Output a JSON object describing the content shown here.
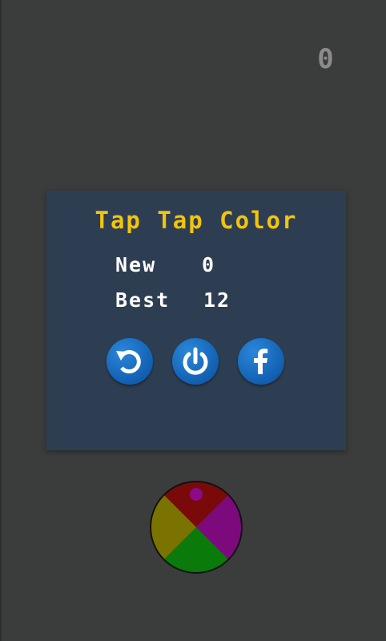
{
  "hud": {
    "current_score": "0"
  },
  "game_over_panel": {
    "title": "Tap Tap Color",
    "new_label": "New",
    "new_value": "0",
    "best_label": "Best",
    "best_value": "12",
    "buttons": [
      {
        "icon": "restart-icon"
      },
      {
        "icon": "power-icon"
      },
      {
        "icon": "facebook-icon"
      }
    ]
  },
  "color_wheel": {
    "segments": [
      {
        "position": "top",
        "color": "#7a0a0a"
      },
      {
        "position": "right",
        "color": "#7d0a7d"
      },
      {
        "position": "bottom",
        "color": "#0a7a0a"
      },
      {
        "position": "left",
        "color": "#7a7300"
      }
    ],
    "ball_color": "#8a0a8a"
  },
  "colors": {
    "background": "#3a3d3c",
    "panel": "#2e3e52",
    "title": "#f1c40f",
    "button": "#1565b8"
  }
}
